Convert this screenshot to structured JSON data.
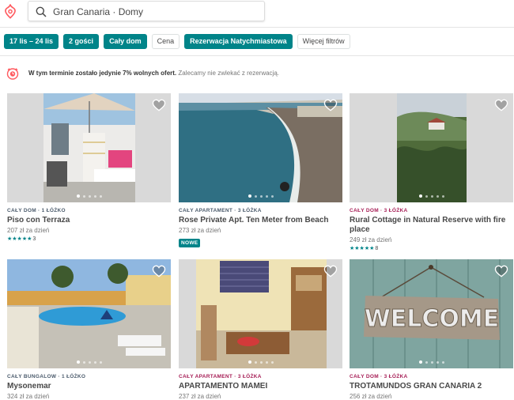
{
  "header": {
    "search_value": "Gran Canaria · Domy"
  },
  "filters": [
    {
      "label": "17 lis – 24 lis",
      "active": true
    },
    {
      "label": "2 gości",
      "active": true
    },
    {
      "label": "Cały dom",
      "active": true
    },
    {
      "label": "Cena",
      "active": false
    },
    {
      "label": "Rezerwacja Natychmiastowa",
      "active": true
    },
    {
      "label": "Więcej filtrów",
      "active": false
    }
  ],
  "notice": {
    "bold": "W tym terminie zostało jedynie 7% wolnych ofert.",
    "text": "Zalecamy nie zwlekać z rezerwacją."
  },
  "listings": [
    {
      "type": "CAŁY DOM · 1 ŁÓŻKO",
      "title": "Piso con Terraza",
      "price": "207 zł za dzień",
      "stars": "★★★★★",
      "reviews": "3"
    },
    {
      "type": "CAŁY APARTAMENT · 3 ŁÓŻKA",
      "title": "Rose Private Apt. Ten Meter from Beach",
      "price": "273 zł za dzień",
      "badge": "NOWE"
    },
    {
      "type": "CAŁY DOM · 3 ŁÓŻKA",
      "title": "Rural Cottage in Natural Reserve with fire place",
      "price": "249 zł za dzień",
      "stars": "★★★★★",
      "reviews": "8"
    },
    {
      "type": "CAŁY BUNGALOW · 1 ŁÓŻKO",
      "title": "Mysonemar",
      "price": "324 zł za dzień"
    },
    {
      "type": "CAŁY APARTAMENT · 3 ŁÓŻKA",
      "title": "APARTAMENTO MAMEI",
      "price": "237 zł za dzień"
    },
    {
      "type": "CAŁY DOM · 3 ŁÓŻKA",
      "title": "TROTAMUNDOS GRAN CANARIA 2",
      "price": "256 zł za dzień"
    }
  ],
  "photo_text": {
    "welcome_sign": "WELCOME"
  },
  "colors": {
    "brand": "#FF5A5F",
    "accent": "#008489",
    "type_label_red": "#A61D55"
  }
}
